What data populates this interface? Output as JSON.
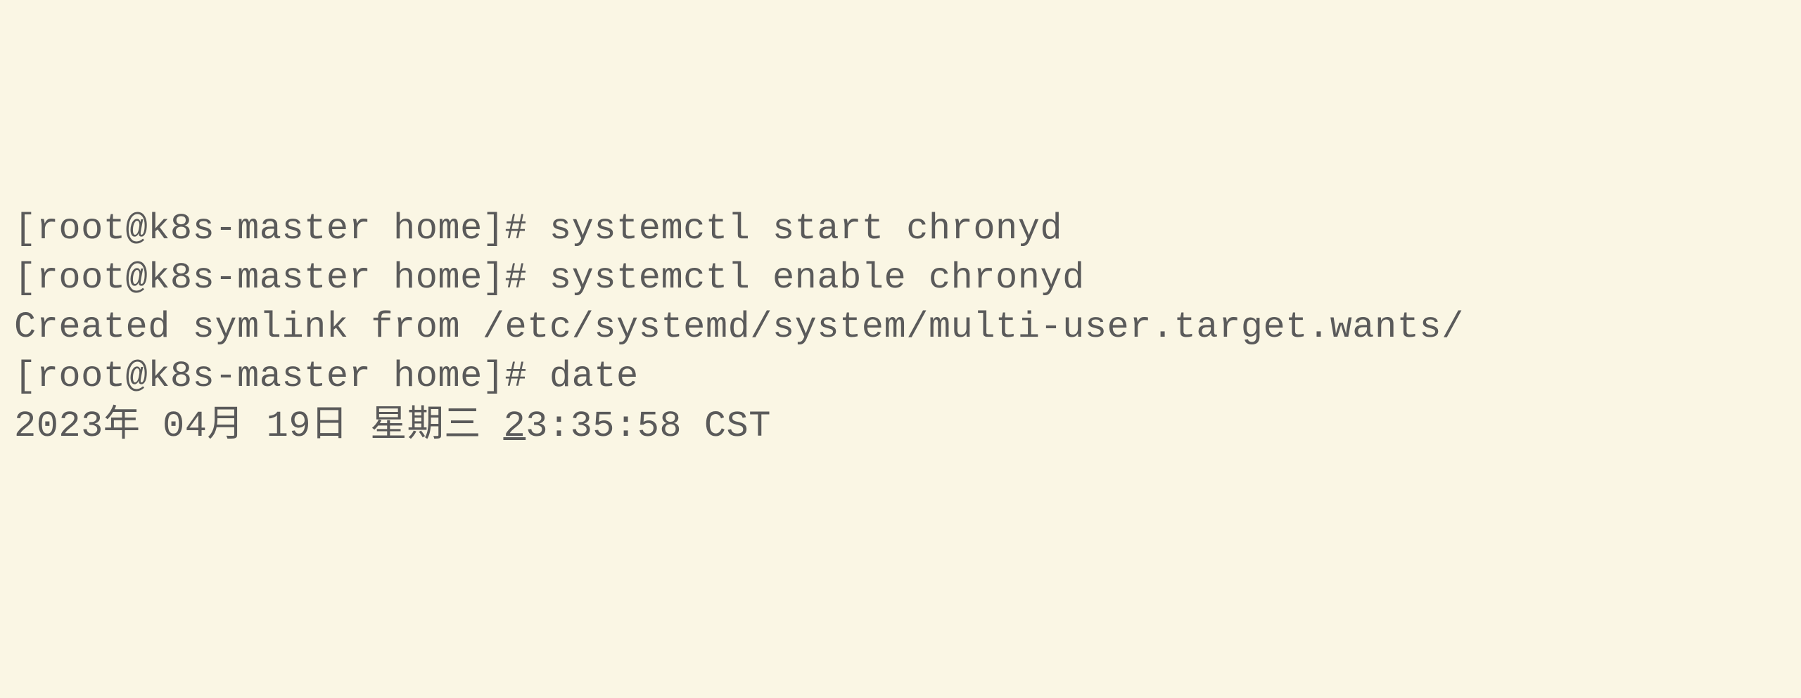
{
  "terminal": {
    "lines": [
      {
        "prompt": "[root@k8s-master home]# ",
        "command": "systemctl start chronyd"
      },
      {
        "prompt": "[root@k8s-master home]# ",
        "command": "systemctl enable chronyd"
      },
      {
        "output": "Created symlink from /etc/systemd/system/multi-user.target.wants/"
      },
      {
        "prompt": "[root@k8s-master home]# ",
        "command": "date"
      },
      {
        "output_pre": "2023年 04月 19日 星期三 ",
        "output_cursor": "2",
        "output_post": "3:35:58 CST"
      }
    ]
  }
}
